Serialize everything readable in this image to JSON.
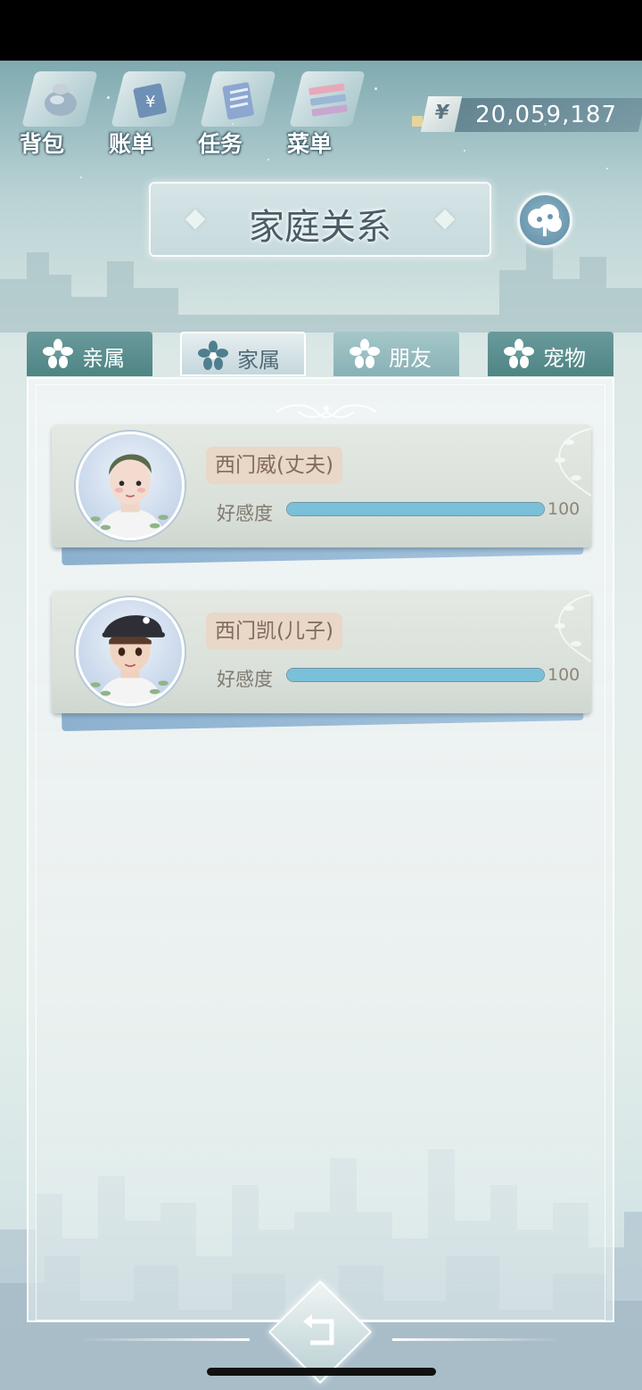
{
  "toolbar": {
    "bag_label": "背包",
    "bill_label": "账单",
    "task_label": "任务",
    "menu_label": "菜单"
  },
  "currency": {
    "symbol": "¥",
    "amount": "20,059,187"
  },
  "header": {
    "title": "家庭关系"
  },
  "tabs": [
    {
      "label": "亲属",
      "active": false
    },
    {
      "label": "家属",
      "active": true
    },
    {
      "label": "朋友",
      "active": false
    },
    {
      "label": "宠物",
      "active": false
    }
  ],
  "members": [
    {
      "name": "西门威(丈夫)",
      "affinity_label": "好感度",
      "affinity_value": "100",
      "affinity_fraction": 1.0
    },
    {
      "name": "西门凯(儿子)",
      "affinity_label": "好感度",
      "affinity_value": "100",
      "affinity_fraction": 1.0
    }
  ],
  "icons": {
    "bag": "bag-icon",
    "bill": "bill-icon",
    "task": "task-icon",
    "menu": "menu-icon",
    "family_tree": "family-tree-icon",
    "back": "back-arrow-icon",
    "tab_flower": "flower-icon"
  },
  "colors": {
    "bar_fill": "#79c0d8",
    "name_tag": "#e9d7c7",
    "title_text": "#4a5d66"
  }
}
